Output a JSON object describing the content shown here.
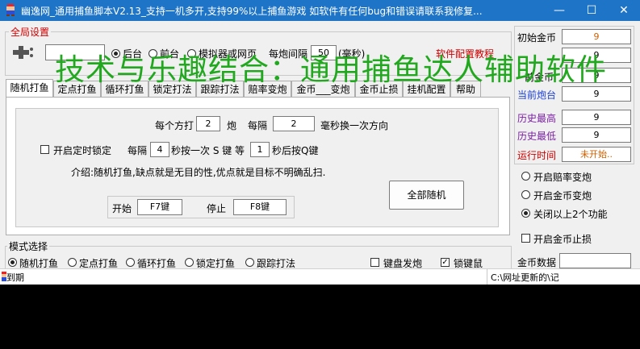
{
  "window": {
    "title": "幽逸网_通用捕鱼脚本V2.13_支持一机多开,支持99%以上捕鱼游戏  如软件有任何bug和错误请联系我修复...",
    "minimize_glyph": "—",
    "maximize_glyph": "☐",
    "close_glyph": "✕"
  },
  "global": {
    "legend": "全局设置",
    "radio_1": "后台",
    "radio_2": "前台",
    "radio_3": "模拟器或网页",
    "shot_interval_label": "每炮间隔",
    "shot_interval_value": "50",
    "shot_interval_unit": "(毫秒)",
    "config_tutorial_link": "软件配置教程"
  },
  "overlay_text": "技术与乐趣结合：通用捕鱼达人辅助软件",
  "tabs": [
    "随机打鱼",
    "定点打鱼",
    "循环打鱼",
    "锁定打法",
    "跟踪打法",
    "赔率变炮",
    "金币___变炮",
    "金币止损",
    "挂机配置",
    "帮助"
  ],
  "random": {
    "every_dir_prefix": "每个方打",
    "shots_value": "2",
    "shots_unit": "炮",
    "every_label": "每隔",
    "ms_value": "2",
    "ms_suffix": "毫秒换一次方向",
    "timer_lock_label": "开启定时锁定",
    "every2_label": "每隔",
    "sec_value": "4",
    "sec_suffix": "秒按一次 S 键 等",
    "wait_value": "1",
    "wait_suffix": "秒后按Q键",
    "intro_text": "介绍:随机打鱼,缺点就是无目的性,优点就是目标不明确乱扫.",
    "start_label": "开始",
    "start_key": "F7键",
    "stop_label": "停止",
    "stop_key": "F8键",
    "all_random_button": "全部随机"
  },
  "mode": {
    "legend": "模式选择",
    "options": [
      "随机打鱼",
      "定点打鱼",
      "循环打鱼",
      "锁定打鱼",
      "跟踪打法"
    ],
    "keyboard_fire": "键盘发炮",
    "lock_key": "锁键鼠"
  },
  "stats": {
    "initial_coins_label": "初始金币",
    "initial_coins_value": "9",
    "row2_value": "9",
    "row3_label_partial": "前金币",
    "row3_value": "9",
    "current_turret_label": "当前炮台",
    "current_turret_value": "9",
    "history_high_label": "历史最高",
    "history_high_value": "9",
    "history_low_label": "历史最低",
    "history_low_value": "9",
    "run_time_label": "运行时间",
    "run_time_value": "未开始.."
  },
  "options": {
    "odds_turret": "开启赔率变炮",
    "coins_turret": "开启金币变炮",
    "close_both": "关闭以上2个功能",
    "coin_stoploss": "开启金币止损",
    "coin_data_label": "金币数据"
  },
  "status": {
    "left_text": "到期",
    "right_text": "C:\\网址更新的\\记"
  }
}
